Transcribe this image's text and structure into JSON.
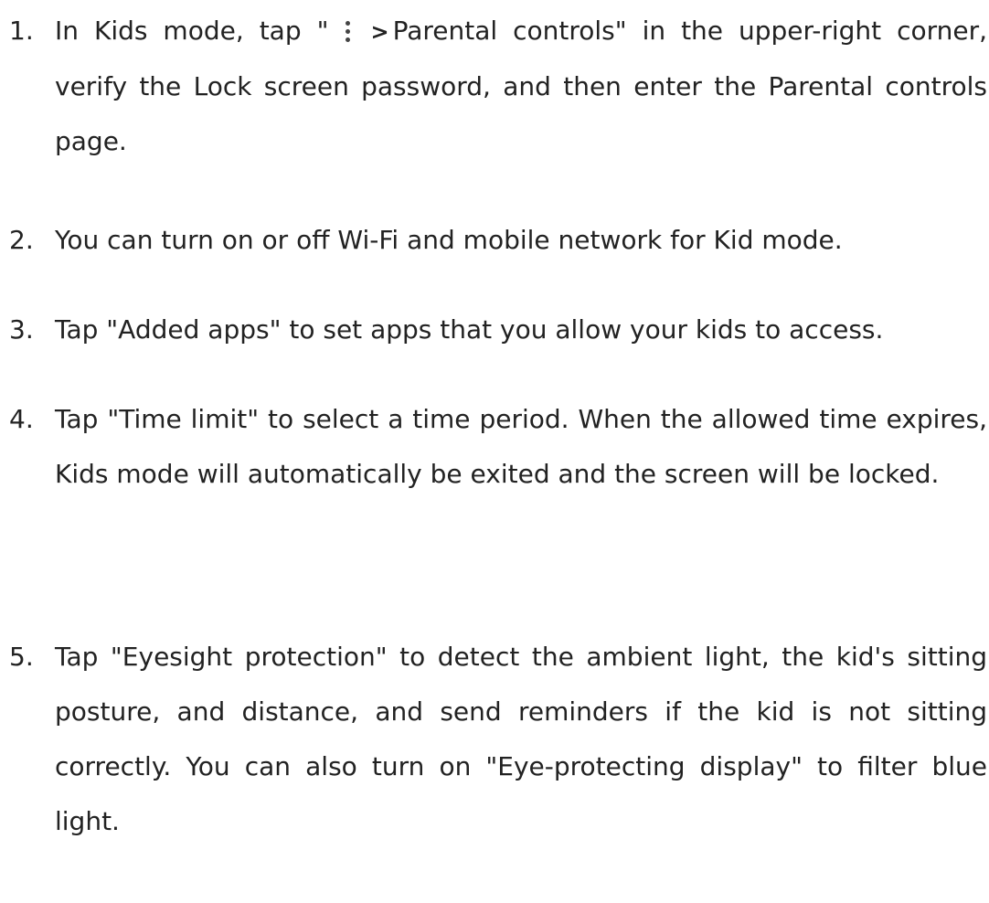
{
  "steps": [
    {
      "num": "1.",
      "part1": "In Kids mode, tap \"",
      "icon": "more-vertical-icon",
      "arrow": ">",
      "part2": "Parental controls\" in the upper-right corner, verify the Lock screen password, and then enter the Parental controls page."
    },
    {
      "num": "2.",
      "text": "You can turn on or off Wi-Fi and mobile network for Kid mode."
    },
    {
      "num": "3.",
      "text": "Tap \"Added apps\" to set apps that you allow your kids to access."
    },
    {
      "num": "4.",
      "text": "Tap \"Time limit\" to select a time period. When the allowed time expires, Kids mode will automatically be exited and the screen will be locked."
    },
    {
      "num": "5.",
      "text": "Tap \"Eyesight protection\" to detect the ambient light, the kid's sitting posture, and distance, and send reminders if the kid is not sitting correctly. You can also turn on \"Eye-protecting display\" to filter blue light."
    }
  ]
}
